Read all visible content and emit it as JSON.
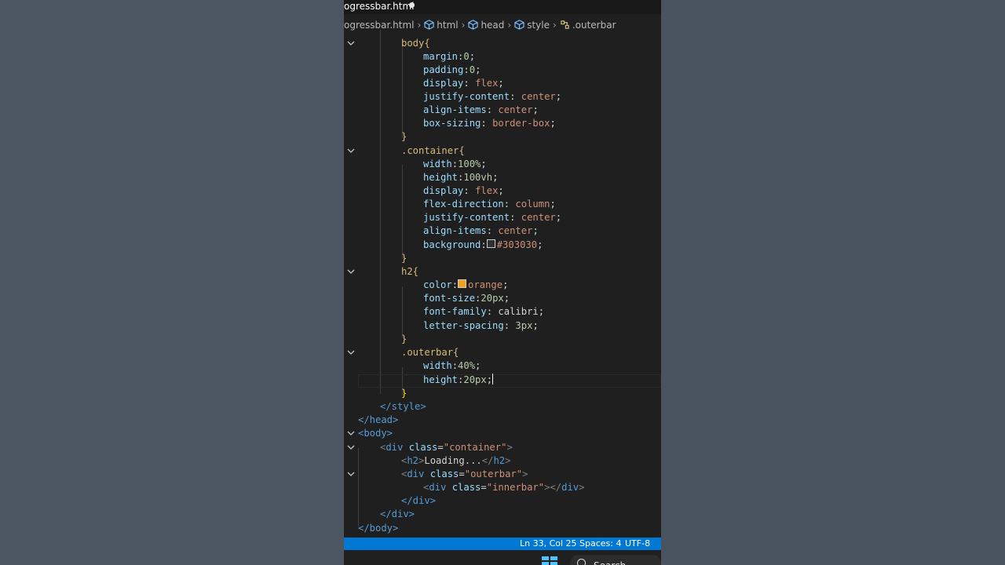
{
  "tab": {
    "filename": "ogressbar.html"
  },
  "breadcrumb": [
    "ogressbar.html",
    "html",
    "head",
    "style",
    ".outerbar"
  ],
  "code": {
    "l0": {
      "text": "body{"
    },
    "l1": {
      "prop": "margin",
      "val": "0"
    },
    "l2": {
      "prop": "padding",
      "val": "0"
    },
    "l3": {
      "prop": "display",
      "val": "flex"
    },
    "l4": {
      "prop": "justify-content",
      "val": "center"
    },
    "l5": {
      "prop": "align-items",
      "val": "center"
    },
    "l6": {
      "prop": "box-sizing",
      "val": "border-box"
    },
    "l8": {
      "text": ".container{"
    },
    "l9": {
      "prop": "width",
      "val": "100%"
    },
    "l10": {
      "prop": "height",
      "val": "100vh"
    },
    "l11": {
      "prop": "display",
      "val": "flex"
    },
    "l12": {
      "prop": "flex-direction",
      "val": "column"
    },
    "l13": {
      "prop": "justify-content",
      "val": "center"
    },
    "l14": {
      "prop": "align-items",
      "val": "center"
    },
    "l15": {
      "prop": "background",
      "val": "#303030"
    },
    "l17": {
      "text": "h2{"
    },
    "l18": {
      "prop": "color",
      "val": "orange"
    },
    "l19": {
      "prop": "font-size",
      "val": "20px"
    },
    "l20": {
      "prop": "font-family",
      "val": "calibri"
    },
    "l21": {
      "prop": "letter-spacing",
      "val": "3px"
    },
    "l23": {
      "text": ".outerbar{"
    },
    "l24": {
      "prop": "width",
      "val": "40%"
    },
    "l25": {
      "prop": "height",
      "val": "20px"
    },
    "l27": {
      "text": "</style>"
    },
    "l28": {
      "text": "</head>"
    },
    "l29": {
      "text": "<body>"
    },
    "l30": {
      "tag": "div",
      "attr": "class",
      "val": "\"container\""
    },
    "l31": {
      "text": "Loading..."
    },
    "l32": {
      "tag": "div",
      "attr": "class",
      "val": "\"outerbar\""
    },
    "l33": {
      "tag": "div",
      "attr": "class",
      "val": "\"innerbar\""
    },
    "l34": {
      "text": "</div>"
    },
    "l35": {
      "text": "</div>"
    },
    "l36": {
      "text": "</body>"
    }
  },
  "colors": {
    "swatch_background": "#303030",
    "swatch_orange": "#f0a020"
  },
  "status": {
    "position": "Ln 33, Col 25",
    "spaces": "Spaces: 4",
    "encoding": "UTF-8"
  },
  "taskbar": {
    "search_label": "Search"
  }
}
